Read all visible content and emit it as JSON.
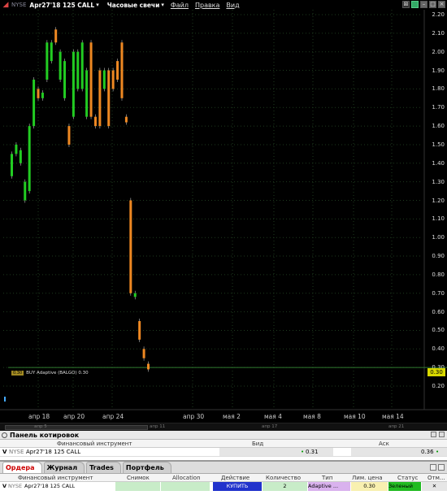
{
  "toolbar": {
    "exchange": "NYSE",
    "contract": "Apr27'18 125 CALL",
    "chart_type": "Часовые свечи",
    "menu": [
      "Файл",
      "Правка",
      "Вид"
    ]
  },
  "chart": {
    "price_labels": [
      "2.20",
      "2.10",
      "2.00",
      "1.90",
      "1.80",
      "1.70",
      "1.60",
      "1.50",
      "1.40",
      "1.30",
      "1.20",
      "1.10",
      "1.00",
      "0.90",
      "0.80",
      "0.70",
      "0.60",
      "0.50",
      "0.40",
      "0.30",
      "0.20"
    ],
    "date_labels": [
      "апр 18",
      "апр 20",
      "апр 24",
      "апр 30",
      "мая 2",
      "мая 4",
      "мая 8",
      "мая 10",
      "мая 14"
    ],
    "current_price": "0.30",
    "order_tag_box": "0.30",
    "order_tag_text": "BUY Adaptive (BALGO) 0.30",
    "scroll_labels": [
      "апр 5",
      "апр 11",
      "апр 17",
      "апр 21"
    ],
    "colors": {
      "up": "#22cc22",
      "down": "#ee8822",
      "grid": "#1e3a1e",
      "order_line": "#2f7a2f"
    }
  },
  "chart_data": {
    "type": "candlestick",
    "y_range": [
      0.2,
      2.2
    ],
    "candles": [
      {
        "dir": "up",
        "open": 1.33,
        "close": 1.45
      },
      {
        "dir": "up",
        "open": 1.45,
        "close": 1.5
      },
      {
        "dir": "up",
        "open": 1.4,
        "close": 1.47
      },
      {
        "dir": "up",
        "open": 1.2,
        "close": 1.3
      },
      {
        "dir": "up",
        "open": 1.25,
        "close": 1.6
      },
      {
        "dir": "up",
        "open": 1.6,
        "close": 1.85
      },
      {
        "dir": "down",
        "open": 1.8,
        "close": 1.75
      },
      {
        "dir": "up",
        "open": 1.75,
        "close": 1.78
      },
      {
        "dir": "up",
        "open": 1.85,
        "close": 2.05
      },
      {
        "dir": "up",
        "open": 1.95,
        "close": 2.05
      },
      {
        "dir": "down",
        "open": 2.12,
        "close": 2.05
      },
      {
        "dir": "up",
        "open": 1.85,
        "close": 2.0
      },
      {
        "dir": "up",
        "open": 1.75,
        "close": 1.95
      },
      {
        "dir": "down",
        "open": 1.6,
        "close": 1.5
      },
      {
        "dir": "up",
        "open": 1.65,
        "close": 2.0
      },
      {
        "dir": "up",
        "open": 1.8,
        "close": 2.0
      },
      {
        "dir": "up",
        "open": 1.8,
        "close": 2.05
      },
      {
        "dir": "up",
        "open": 1.65,
        "close": 1.9
      },
      {
        "dir": "down",
        "open": 2.05,
        "close": 1.65
      },
      {
        "dir": "down",
        "open": 1.6,
        "close": 1.65
      },
      {
        "dir": "down",
        "open": 1.6,
        "close": 1.9
      },
      {
        "dir": "up",
        "open": 1.8,
        "close": 1.9
      },
      {
        "dir": "down",
        "open": 1.9,
        "close": 1.6
      },
      {
        "dir": "down",
        "open": 1.8,
        "close": 1.9
      },
      {
        "dir": "down",
        "open": 1.95,
        "close": 1.85
      },
      {
        "dir": "down",
        "open": 2.05,
        "close": 1.75
      },
      {
        "dir": "down",
        "open": 1.65,
        "close": 1.62
      },
      {
        "dir": "down",
        "open": 1.2,
        "close": 0.7
      },
      {
        "dir": "up",
        "open": 0.68,
        "close": 0.7
      },
      {
        "dir": "down",
        "open": 0.55,
        "close": 0.45
      },
      {
        "dir": "down",
        "open": 0.4,
        "close": 0.35
      },
      {
        "dir": "down",
        "open": 0.32,
        "close": 0.29
      }
    ]
  },
  "quote_panel": {
    "title": "Панель котировок",
    "columns": [
      "Финансовый инструмент",
      "Бид",
      "Аск"
    ],
    "row": {
      "prefix": "V",
      "exchange": "NYSE",
      "instrument": "Apr27'18 125 CALL",
      "bid": "0.31",
      "ask": "0.36"
    }
  },
  "orders_panel": {
    "tabs": [
      "Ордера",
      "Журнал",
      "Trades",
      "Портфель"
    ],
    "columns": [
      "Финансовый инструмент",
      "Снимок",
      "Allocation",
      "Действие",
      "Количество",
      "Тип",
      "Лим. цена",
      "Статус",
      "Отм..."
    ],
    "row": {
      "prefix": "V",
      "exchange": "NYSE",
      "instrument": "Apr27'18 125 CALL",
      "action": "КУПИТЬ",
      "quantity": "2",
      "type": "Adaptive ...",
      "limit_price": "0.30",
      "status": "Зеленый"
    }
  }
}
